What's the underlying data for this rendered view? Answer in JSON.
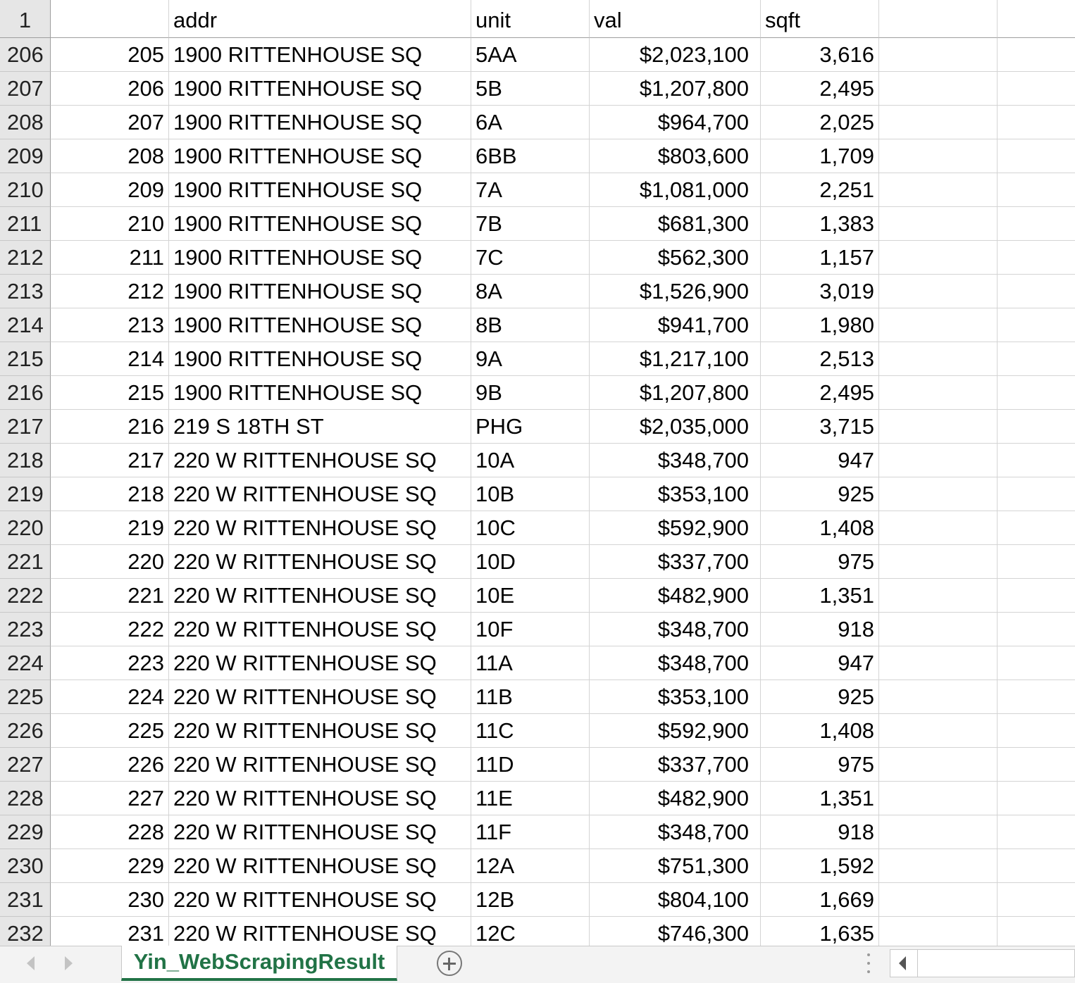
{
  "sheet": {
    "header_row_number": "1",
    "headers": [
      "",
      "addr",
      "unit",
      "val",
      "sqft"
    ],
    "rows": [
      {
        "row": "206",
        "idx": "205",
        "addr": "1900 RITTENHOUSE SQ",
        "unit": "5AA",
        "val": "$2,023,100",
        "sqft": "3,616"
      },
      {
        "row": "207",
        "idx": "206",
        "addr": "1900 RITTENHOUSE SQ",
        "unit": "5B",
        "val": "$1,207,800",
        "sqft": "2,495"
      },
      {
        "row": "208",
        "idx": "207",
        "addr": "1900 RITTENHOUSE SQ",
        "unit": "6A",
        "val": "$964,700",
        "sqft": "2,025"
      },
      {
        "row": "209",
        "idx": "208",
        "addr": "1900 RITTENHOUSE SQ",
        "unit": "6BB",
        "val": "$803,600",
        "sqft": "1,709"
      },
      {
        "row": "210",
        "idx": "209",
        "addr": "1900 RITTENHOUSE SQ",
        "unit": "7A",
        "val": "$1,081,000",
        "sqft": "2,251"
      },
      {
        "row": "211",
        "idx": "210",
        "addr": "1900 RITTENHOUSE SQ",
        "unit": "7B",
        "val": "$681,300",
        "sqft": "1,383"
      },
      {
        "row": "212",
        "idx": "211",
        "addr": "1900 RITTENHOUSE SQ",
        "unit": "7C",
        "val": "$562,300",
        "sqft": "1,157"
      },
      {
        "row": "213",
        "idx": "212",
        "addr": "1900 RITTENHOUSE SQ",
        "unit": "8A",
        "val": "$1,526,900",
        "sqft": "3,019"
      },
      {
        "row": "214",
        "idx": "213",
        "addr": "1900 RITTENHOUSE SQ",
        "unit": "8B",
        "val": "$941,700",
        "sqft": "1,980"
      },
      {
        "row": "215",
        "idx": "214",
        "addr": "1900 RITTENHOUSE SQ",
        "unit": "9A",
        "val": "$1,217,100",
        "sqft": "2,513"
      },
      {
        "row": "216",
        "idx": "215",
        "addr": "1900 RITTENHOUSE SQ",
        "unit": "9B",
        "val": "$1,207,800",
        "sqft": "2,495"
      },
      {
        "row": "217",
        "idx": "216",
        "addr": "219 S 18TH ST",
        "unit": "PHG",
        "val": "$2,035,000",
        "sqft": "3,715"
      },
      {
        "row": "218",
        "idx": "217",
        "addr": "220 W RITTENHOUSE SQ",
        "unit": "10A",
        "val": "$348,700",
        "sqft": "947"
      },
      {
        "row": "219",
        "idx": "218",
        "addr": "220 W RITTENHOUSE SQ",
        "unit": "10B",
        "val": "$353,100",
        "sqft": "925"
      },
      {
        "row": "220",
        "idx": "219",
        "addr": "220 W RITTENHOUSE SQ",
        "unit": "10C",
        "val": "$592,900",
        "sqft": "1,408"
      },
      {
        "row": "221",
        "idx": "220",
        "addr": "220 W RITTENHOUSE SQ",
        "unit": "10D",
        "val": "$337,700",
        "sqft": "975"
      },
      {
        "row": "222",
        "idx": "221",
        "addr": "220 W RITTENHOUSE SQ",
        "unit": "10E",
        "val": "$482,900",
        "sqft": "1,351"
      },
      {
        "row": "223",
        "idx": "222",
        "addr": "220 W RITTENHOUSE SQ",
        "unit": "10F",
        "val": "$348,700",
        "sqft": "918"
      },
      {
        "row": "224",
        "idx": "223",
        "addr": "220 W RITTENHOUSE SQ",
        "unit": "11A",
        "val": "$348,700",
        "sqft": "947"
      },
      {
        "row": "225",
        "idx": "224",
        "addr": "220 W RITTENHOUSE SQ",
        "unit": "11B",
        "val": "$353,100",
        "sqft": "925"
      },
      {
        "row": "226",
        "idx": "225",
        "addr": "220 W RITTENHOUSE SQ",
        "unit": "11C",
        "val": "$592,900",
        "sqft": "1,408"
      },
      {
        "row": "227",
        "idx": "226",
        "addr": "220 W RITTENHOUSE SQ",
        "unit": "11D",
        "val": "$337,700",
        "sqft": "975"
      },
      {
        "row": "228",
        "idx": "227",
        "addr": "220 W RITTENHOUSE SQ",
        "unit": "11E",
        "val": "$482,900",
        "sqft": "1,351"
      },
      {
        "row": "229",
        "idx": "228",
        "addr": "220 W RITTENHOUSE SQ",
        "unit": "11F",
        "val": "$348,700",
        "sqft": "918"
      },
      {
        "row": "230",
        "idx": "229",
        "addr": "220 W RITTENHOUSE SQ",
        "unit": "12A",
        "val": "$751,300",
        "sqft": "1,592"
      },
      {
        "row": "231",
        "idx": "230",
        "addr": "220 W RITTENHOUSE SQ",
        "unit": "12B",
        "val": "$804,100",
        "sqft": "1,669"
      },
      {
        "row": "232",
        "idx": "231",
        "addr": "220 W RITTENHOUSE SQ",
        "unit": "12C",
        "val": "$746,300",
        "sqft": "1,635"
      }
    ]
  },
  "tabbar": {
    "sheet_tab_label": "Yin_WebScrapingResult",
    "accent_color": "#217346",
    "icons": [
      "prev-sheet-icon",
      "next-sheet-icon",
      "add-sheet-icon",
      "scroll-left-icon"
    ]
  }
}
